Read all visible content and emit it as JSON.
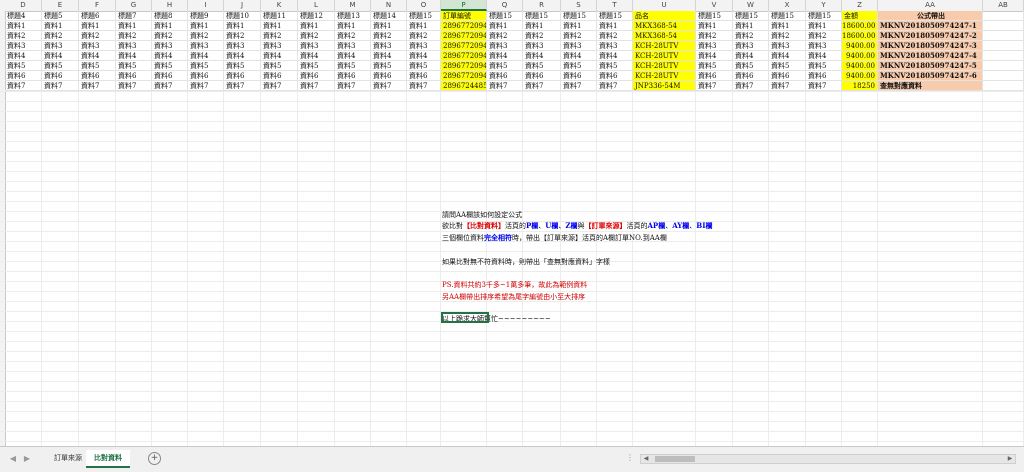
{
  "columns": {
    "letters": [
      "D",
      "E",
      "F",
      "G",
      "H",
      "I",
      "J",
      "K",
      "L",
      "M",
      "N",
      "O",
      "P",
      "Q",
      "R",
      "S",
      "T",
      "U",
      "V",
      "W",
      "X",
      "Y",
      "Z",
      "AA",
      "AB"
    ],
    "selected": "P"
  },
  "headers": [
    "標題4",
    "標題5",
    "標題6",
    "標題7",
    "標題8",
    "標題9",
    "標題10",
    "標題11",
    "標題12",
    "標題13",
    "標題14",
    "標題15",
    "訂單編號",
    "標題15",
    "標題15",
    "標題15",
    "標題15",
    "品名",
    "標題15",
    "標題15",
    "標題15",
    "標題15",
    "金額",
    "公式帶出",
    ""
  ],
  "rows": [
    [
      "資料1",
      "資料1",
      "資料1",
      "資料1",
      "資料1",
      "資料1",
      "資料1",
      "資料1",
      "資料1",
      "資料1",
      "資料1",
      "資料1",
      "2896772094",
      "資料1",
      "資料1",
      "資料1",
      "資料1",
      "MKX368-54",
      "資料1",
      "資料1",
      "資料1",
      "資料1",
      "18600.00",
      "MKNV2018050974247-1",
      ""
    ],
    [
      "資料2",
      "資料2",
      "資料2",
      "資料2",
      "資料2",
      "資料2",
      "資料2",
      "資料2",
      "資料2",
      "資料2",
      "資料2",
      "資料2",
      "2896772094",
      "資料2",
      "資料2",
      "資料2",
      "資料2",
      "MKX368-54",
      "資料2",
      "資料2",
      "資料2",
      "資料2",
      "18600.00",
      "MKNV2018050974247-2",
      ""
    ],
    [
      "資料3",
      "資料3",
      "資料3",
      "資料3",
      "資料3",
      "資料3",
      "資料3",
      "資料3",
      "資料3",
      "資料3",
      "資料3",
      "資料3",
      "2896772094",
      "資料3",
      "資料3",
      "資料3",
      "資料3",
      "KCH-28UTV",
      "資料3",
      "資料3",
      "資料3",
      "資料3",
      "9400.00",
      "MKNV2018050974247-3",
      ""
    ],
    [
      "資料4",
      "資料4",
      "資料4",
      "資料4",
      "資料4",
      "資料4",
      "資料4",
      "資料4",
      "資料4",
      "資料4",
      "資料4",
      "資料4",
      "2896772094",
      "資料4",
      "資料4",
      "資料4",
      "資料4",
      "KCH-28UTV",
      "資料4",
      "資料4",
      "資料4",
      "資料4",
      "9400.00",
      "MKNV2018050974247-4",
      ""
    ],
    [
      "資料5",
      "資料5",
      "資料5",
      "資料5",
      "資料5",
      "資料5",
      "資料5",
      "資料5",
      "資料5",
      "資料5",
      "資料5",
      "資料5",
      "2896772094",
      "資料5",
      "資料5",
      "資料5",
      "資料5",
      "KCH-28UTV",
      "資料5",
      "資料5",
      "資料5",
      "資料5",
      "9400.00",
      "MKNV2018050974247-5",
      ""
    ],
    [
      "資料6",
      "資料6",
      "資料6",
      "資料6",
      "資料6",
      "資料6",
      "資料6",
      "資料6",
      "資料6",
      "資料6",
      "資料6",
      "資料6",
      "2896772094",
      "資料6",
      "資料6",
      "資料6",
      "資料6",
      "KCH-28UTV",
      "資料6",
      "資料6",
      "資料6",
      "資料6",
      "9400.00",
      "MKNV2018050974247-6",
      ""
    ],
    [
      "資料7",
      "資料7",
      "資料7",
      "資料7",
      "資料7",
      "資料7",
      "資料7",
      "資料7",
      "資料7",
      "資料7",
      "資料7",
      "資料7",
      "2896724485",
      "資料7",
      "資料7",
      "資料7",
      "資料7",
      "JNP336-54M",
      "資料7",
      "資料7",
      "資料7",
      "資料7",
      "18250",
      "查無對應資料",
      ""
    ]
  ],
  "notes": {
    "line1": "請問AA欄該如何設定公式",
    "line2": [
      {
        "t": "欲比對",
        "s": "plain"
      },
      {
        "t": "【比對資料】",
        "s": "red"
      },
      {
        "t": "活頁的",
        "s": "plain"
      },
      {
        "t": "P欄",
        "s": "blue"
      },
      {
        "t": "、",
        "s": "plain"
      },
      {
        "t": "U欄",
        "s": "blue"
      },
      {
        "t": "、",
        "s": "plain"
      },
      {
        "t": "Z欄",
        "s": "blue"
      },
      {
        "t": "與",
        "s": "plain"
      },
      {
        "t": "【訂單來源】",
        "s": "red"
      },
      {
        "t": "活頁的",
        "s": "plain"
      },
      {
        "t": "AP欄",
        "s": "blue"
      },
      {
        "t": "、",
        "s": "plain"
      },
      {
        "t": "AY欄",
        "s": "blue"
      },
      {
        "t": "、",
        "s": "plain"
      },
      {
        "t": "BI欄",
        "s": "blue"
      }
    ],
    "line3": [
      {
        "t": "三個欄位資料",
        "s": "plain"
      },
      {
        "t": "完全相符",
        "s": "blue"
      },
      {
        "t": "時，帶出【訂單來源】活頁的A欄訂單NO.到AA欄",
        "s": "plain"
      }
    ],
    "line4": "如果比對無不符資料時，則帶出「查無對應資料」字樣",
    "line5": "PS.資料共約3千多~1萬多筆，故此為範例資料",
    "line6": "另AA欄帶出排序希望為尾字編號由小至大排序",
    "line7": "以上跪求大師幫忙~~~~~~~~~"
  },
  "sheet_tabs": [
    "訂單來源",
    "比對資料"
  ],
  "active_tab": 1,
  "colors": {
    "highlight_yellow": "#ffff00",
    "formula_peach": "#f8cbad",
    "excel_green": "#217346",
    "note_red": "#e00000",
    "note_blue": "#0000ee"
  }
}
